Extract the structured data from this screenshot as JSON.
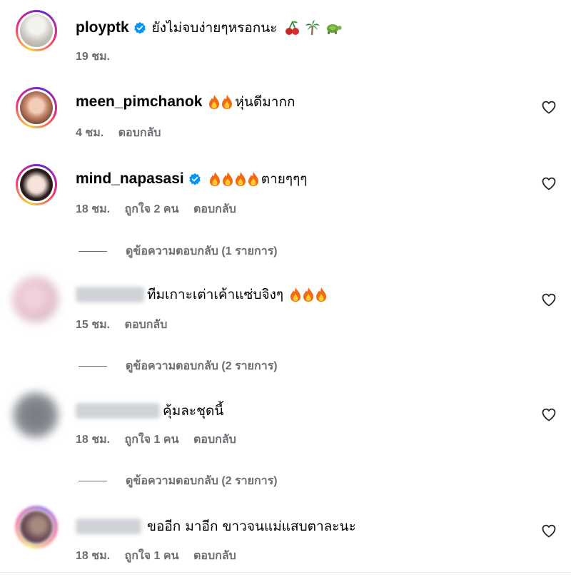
{
  "comments": [
    {
      "username": "ployptk",
      "verified": true,
      "text": "ยังไม่จบง่ายๆหรอกนะ",
      "emoji": [
        "cherry",
        "palm-tree",
        "turtle"
      ],
      "time": "19 ชม.",
      "likes": "",
      "reply": "",
      "avatar_colors": [
        "#d9d9d4",
        "#b9b2a8"
      ]
    },
    {
      "username": "meen_pimchanok",
      "verified": false,
      "text": "หุ่นดีมากก",
      "emoji_before": [
        "fire",
        "fire"
      ],
      "time": "4 ชม.",
      "likes": "",
      "reply": "ตอบกลับ",
      "avatar_colors": [
        "#c98a6d",
        "#6b3a2a"
      ]
    },
    {
      "username": "mind_napasasi",
      "verified": true,
      "text": "ตายๆๆๆ",
      "emoji_before": [
        "fire",
        "fire",
        "fire",
        "fire"
      ],
      "time": "18 ชม.",
      "likes": "ถูกใจ 2 คน",
      "reply": "ตอบกลับ",
      "view_replies": "ดูข้อความตอบกลับ (1 รายการ)",
      "avatar_colors": [
        "#e8d6cf",
        "#2b1f1c"
      ]
    },
    {
      "username": "",
      "verified": false,
      "text": "ทีมเกาะเต่าเค้าแซ่บจิงๆ",
      "emoji_after": [
        "fire",
        "fire",
        "fire"
      ],
      "time": "15 ชม.",
      "likes": "",
      "reply": "ตอบกลับ",
      "view_replies": "ดูข้อความตอบกลับ (2 รายการ)",
      "avatar_colors": [
        "#e2b9c8",
        "#c8cbd6"
      ]
    },
    {
      "username": "",
      "verified": false,
      "text": "คุ้มละชุดนี้",
      "time": "18 ชม.",
      "likes": "ถูกใจ 1 คน",
      "reply": "ตอบกลับ",
      "view_replies": "ดูข้อความตอบกลับ (2 รายการ)",
      "avatar_colors": [
        "#8f9399",
        "#b5b8bc"
      ]
    },
    {
      "username": "",
      "verified": false,
      "text": "ขออีก มาอีก ขาวจนแม่แสบตาละนะ",
      "time": "18 ชม.",
      "likes": "ถูกใจ 1 คน",
      "reply": "ตอบกลับ",
      "avatar_colors": [
        "#6a4b58",
        "#a98a7f"
      ]
    }
  ],
  "colors": {
    "meta_text": "#6b6f73",
    "verified_blue": "#0095f6",
    "flame_outer": "#f36a12",
    "flame_inner": "#ffcc33"
  }
}
